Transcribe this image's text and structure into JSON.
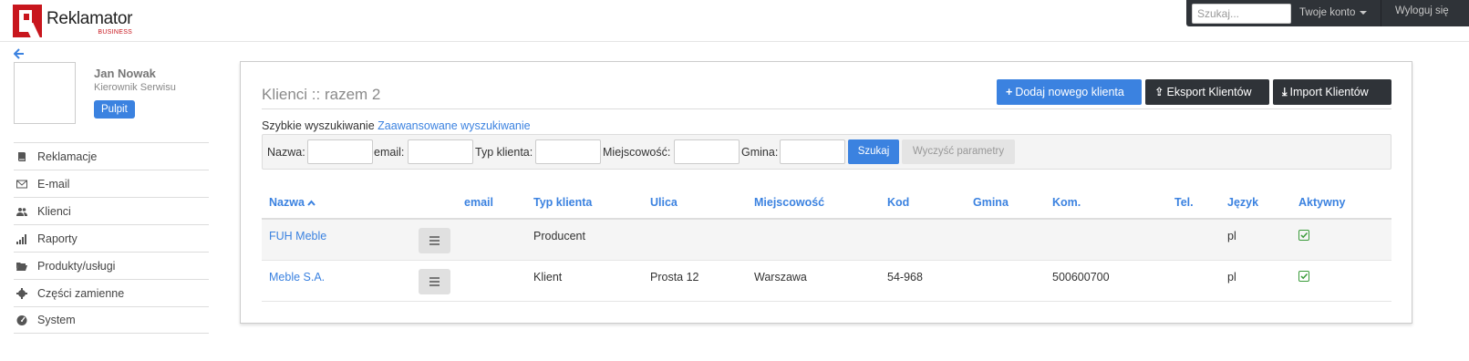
{
  "app": {
    "logo_name": "Reklamator",
    "logo_sub": "BUSINESS"
  },
  "topbar": {
    "search_placeholder": "Szukaj...",
    "account_label": "Twoje konto",
    "logout_label": "Wyloguj się"
  },
  "user": {
    "name": "Jan Nowak",
    "role": "Kierownik Serwisu",
    "dashboard_label": "Pulpit"
  },
  "sidebar": {
    "items": [
      {
        "label": "Reklamacje",
        "icon": "book-icon"
      },
      {
        "label": "E-mail",
        "icon": "envelope-icon"
      },
      {
        "label": "Klienci",
        "icon": "users-icon"
      },
      {
        "label": "Raporty",
        "icon": "signal-icon"
      },
      {
        "label": "Produkty/usługi",
        "icon": "folder-open-icon"
      },
      {
        "label": "Części zamienne",
        "icon": "cog-icon"
      },
      {
        "label": "System",
        "icon": "dashboard-icon"
      }
    ]
  },
  "main": {
    "title": "Klienci :: razem 2",
    "add_label": "Dodaj nowego klienta",
    "export_label": "Eksport Klientów",
    "import_label": "Import Klientów",
    "quick_search_label": "Szybkie wyszukiwanie",
    "advanced_search_label": "Zaawansowane wyszukiwanie"
  },
  "filters": {
    "name_label": "Nazwa:",
    "email_label": "email:",
    "type_label": "Typ klienta:",
    "city_label": "Miejscowość:",
    "commune_label": "Gmina:",
    "search_label": "Szukaj",
    "clear_label": "Wyczyść parametry"
  },
  "table": {
    "columns": [
      "Nazwa",
      "email",
      "Typ klienta",
      "Ulica",
      "Miejscowość",
      "Kod",
      "Gmina",
      "Kom.",
      "Tel.",
      "Język",
      "Aktywny"
    ],
    "sort_indicator": "^",
    "rows": [
      {
        "name": "FUH Meble",
        "email": "",
        "type": "Producent",
        "street": "",
        "city": "",
        "code": "",
        "commune": "",
        "mobile": "",
        "phone": "",
        "lang": "pl",
        "active": true
      },
      {
        "name": "Meble S.A.",
        "email": "",
        "type": "Klient",
        "street": "Prosta 12",
        "city": "Warszawa",
        "code": "54-968",
        "commune": "",
        "mobile": "500600700",
        "phone": "",
        "lang": "pl",
        "active": true
      }
    ]
  },
  "colors": {
    "accent": "#3b82e0",
    "dark": "#2f3338",
    "brand": "#c8161d",
    "success": "#3a9b3a"
  }
}
